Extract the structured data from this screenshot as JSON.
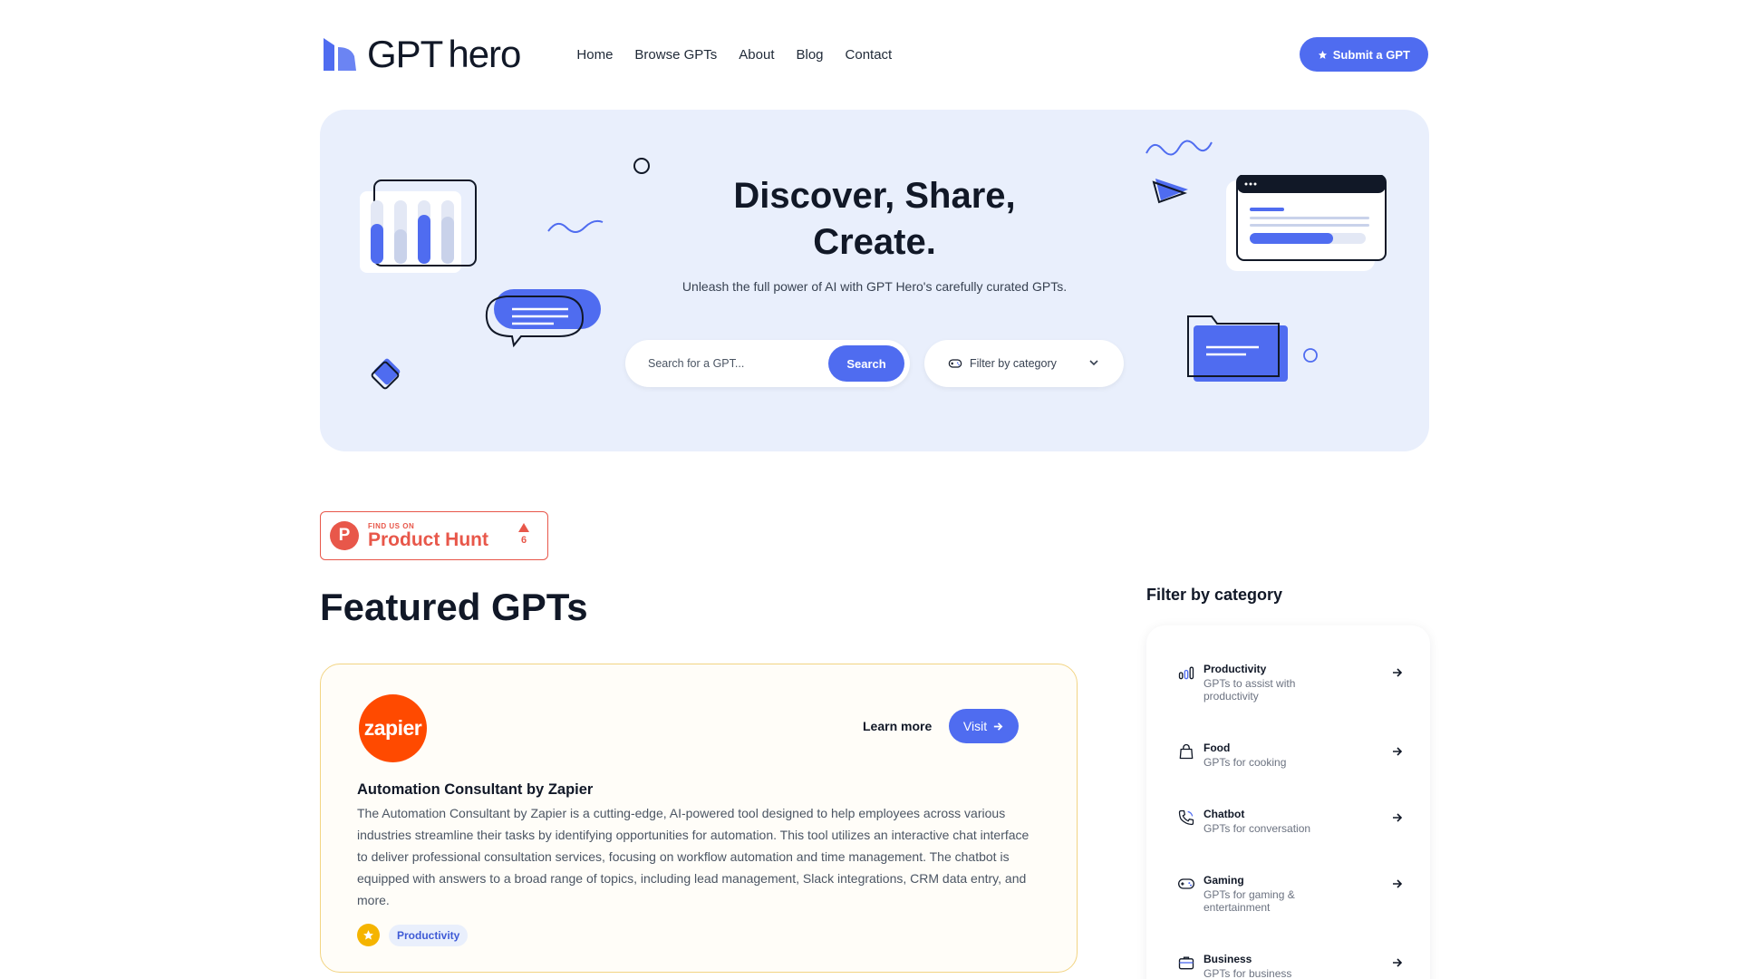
{
  "header": {
    "logo_text_1": "GPT",
    "logo_text_2": "hero",
    "nav": [
      "Home",
      "Browse GPTs",
      "About",
      "Blog",
      "Contact"
    ],
    "submit_label": "Submit a GPT"
  },
  "hero": {
    "title_line_1": "Discover, Share,",
    "title_line_2": "Create.",
    "subtitle": "Unleash the full power of AI with GPT Hero's carefully curated GPTs.",
    "search_placeholder": "Search for a GPT...",
    "search_button": "Search",
    "filter_label": "Filter by category"
  },
  "product_hunt": {
    "small_text": "FIND US ON",
    "big_text": "Product Hunt",
    "letter": "P",
    "votes": "6"
  },
  "featured": {
    "heading": "Featured GPTs",
    "card": {
      "logo_text": "zapier",
      "learn_more": "Learn more",
      "visit": "Visit",
      "title": "Automation Consultant by Zapier",
      "description": "The Automation Consultant by Zapier is a cutting-edge, AI-powered tool designed to help employees across various industries streamline their tasks by identifying opportunities for automation. This tool utilizes an interactive chat interface to deliver professional consultation services, focusing on workflow automation and time management. The chatbot is equipped with answers to a broad range of topics, including lead management, Slack integrations, CRM data entry, and more.",
      "tag": "Productivity"
    }
  },
  "sidebar": {
    "title": "Filter by category",
    "categories": [
      {
        "name": "Productivity",
        "desc": "GPTs to assist with productivity",
        "icon": "bar-chart-icon"
      },
      {
        "name": "Food",
        "desc": "GPTs for cooking",
        "icon": "bag-icon"
      },
      {
        "name": "Chatbot",
        "desc": "GPTs for conversation",
        "icon": "phone-icon"
      },
      {
        "name": "Gaming",
        "desc": "GPTs for gaming & entertainment",
        "icon": "gamepad-icon"
      },
      {
        "name": "Business",
        "desc": "GPTs for business",
        "icon": "briefcase-icon"
      }
    ]
  },
  "colors": {
    "accent": "#4f6cf0",
    "hero_bg": "#e9effc",
    "product_hunt": "#e8574a",
    "zapier": "#ff4a00",
    "card_border": "#f2d483"
  }
}
